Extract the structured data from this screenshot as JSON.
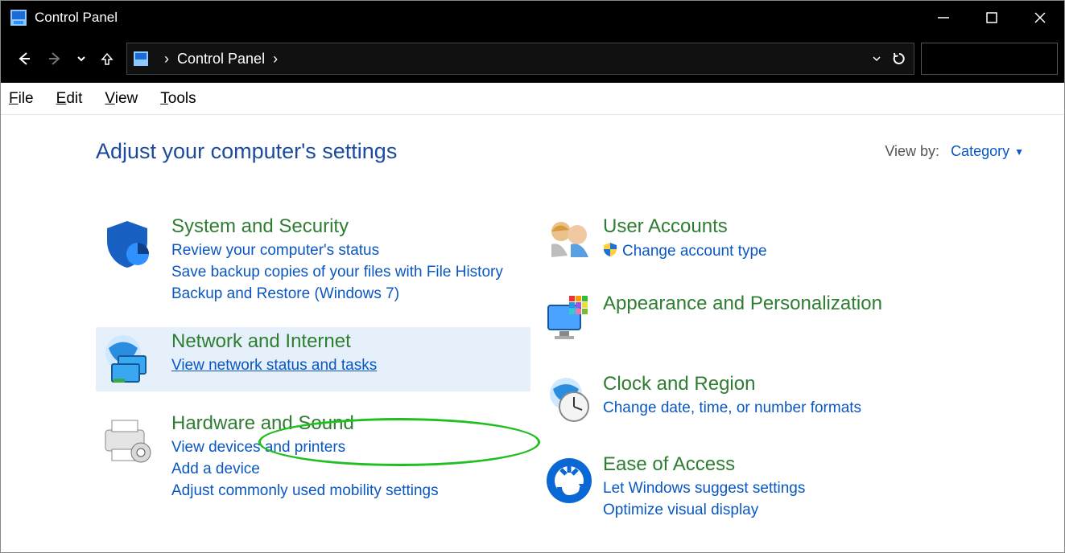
{
  "window": {
    "title": "Control Panel"
  },
  "address": {
    "location": "Control Panel"
  },
  "menus": {
    "file": "File",
    "edit": "Edit",
    "view": "View",
    "tools": "Tools"
  },
  "heading": "Adjust your computer's settings",
  "viewby": {
    "label": "View by:",
    "value": "Category"
  },
  "categories": {
    "system_security": {
      "name": "System and Security",
      "links": [
        "Review your computer's status",
        "Save backup copies of your files with File History",
        "Backup and Restore (Windows 7)"
      ]
    },
    "network": {
      "name": "Network and Internet",
      "links": [
        "View network status and tasks"
      ]
    },
    "hardware": {
      "name": "Hardware and Sound",
      "links": [
        "View devices and printers",
        "Add a device",
        "Adjust commonly used mobility settings"
      ]
    },
    "users": {
      "name": "User Accounts",
      "links": [
        "Change account type"
      ]
    },
    "appearance": {
      "name": "Appearance and Personalization"
    },
    "clock": {
      "name": "Clock and Region",
      "links": [
        "Change date, time, or number formats"
      ]
    },
    "access": {
      "name": "Ease of Access",
      "links": [
        "Let Windows suggest settings",
        "Optimize visual display"
      ]
    }
  }
}
